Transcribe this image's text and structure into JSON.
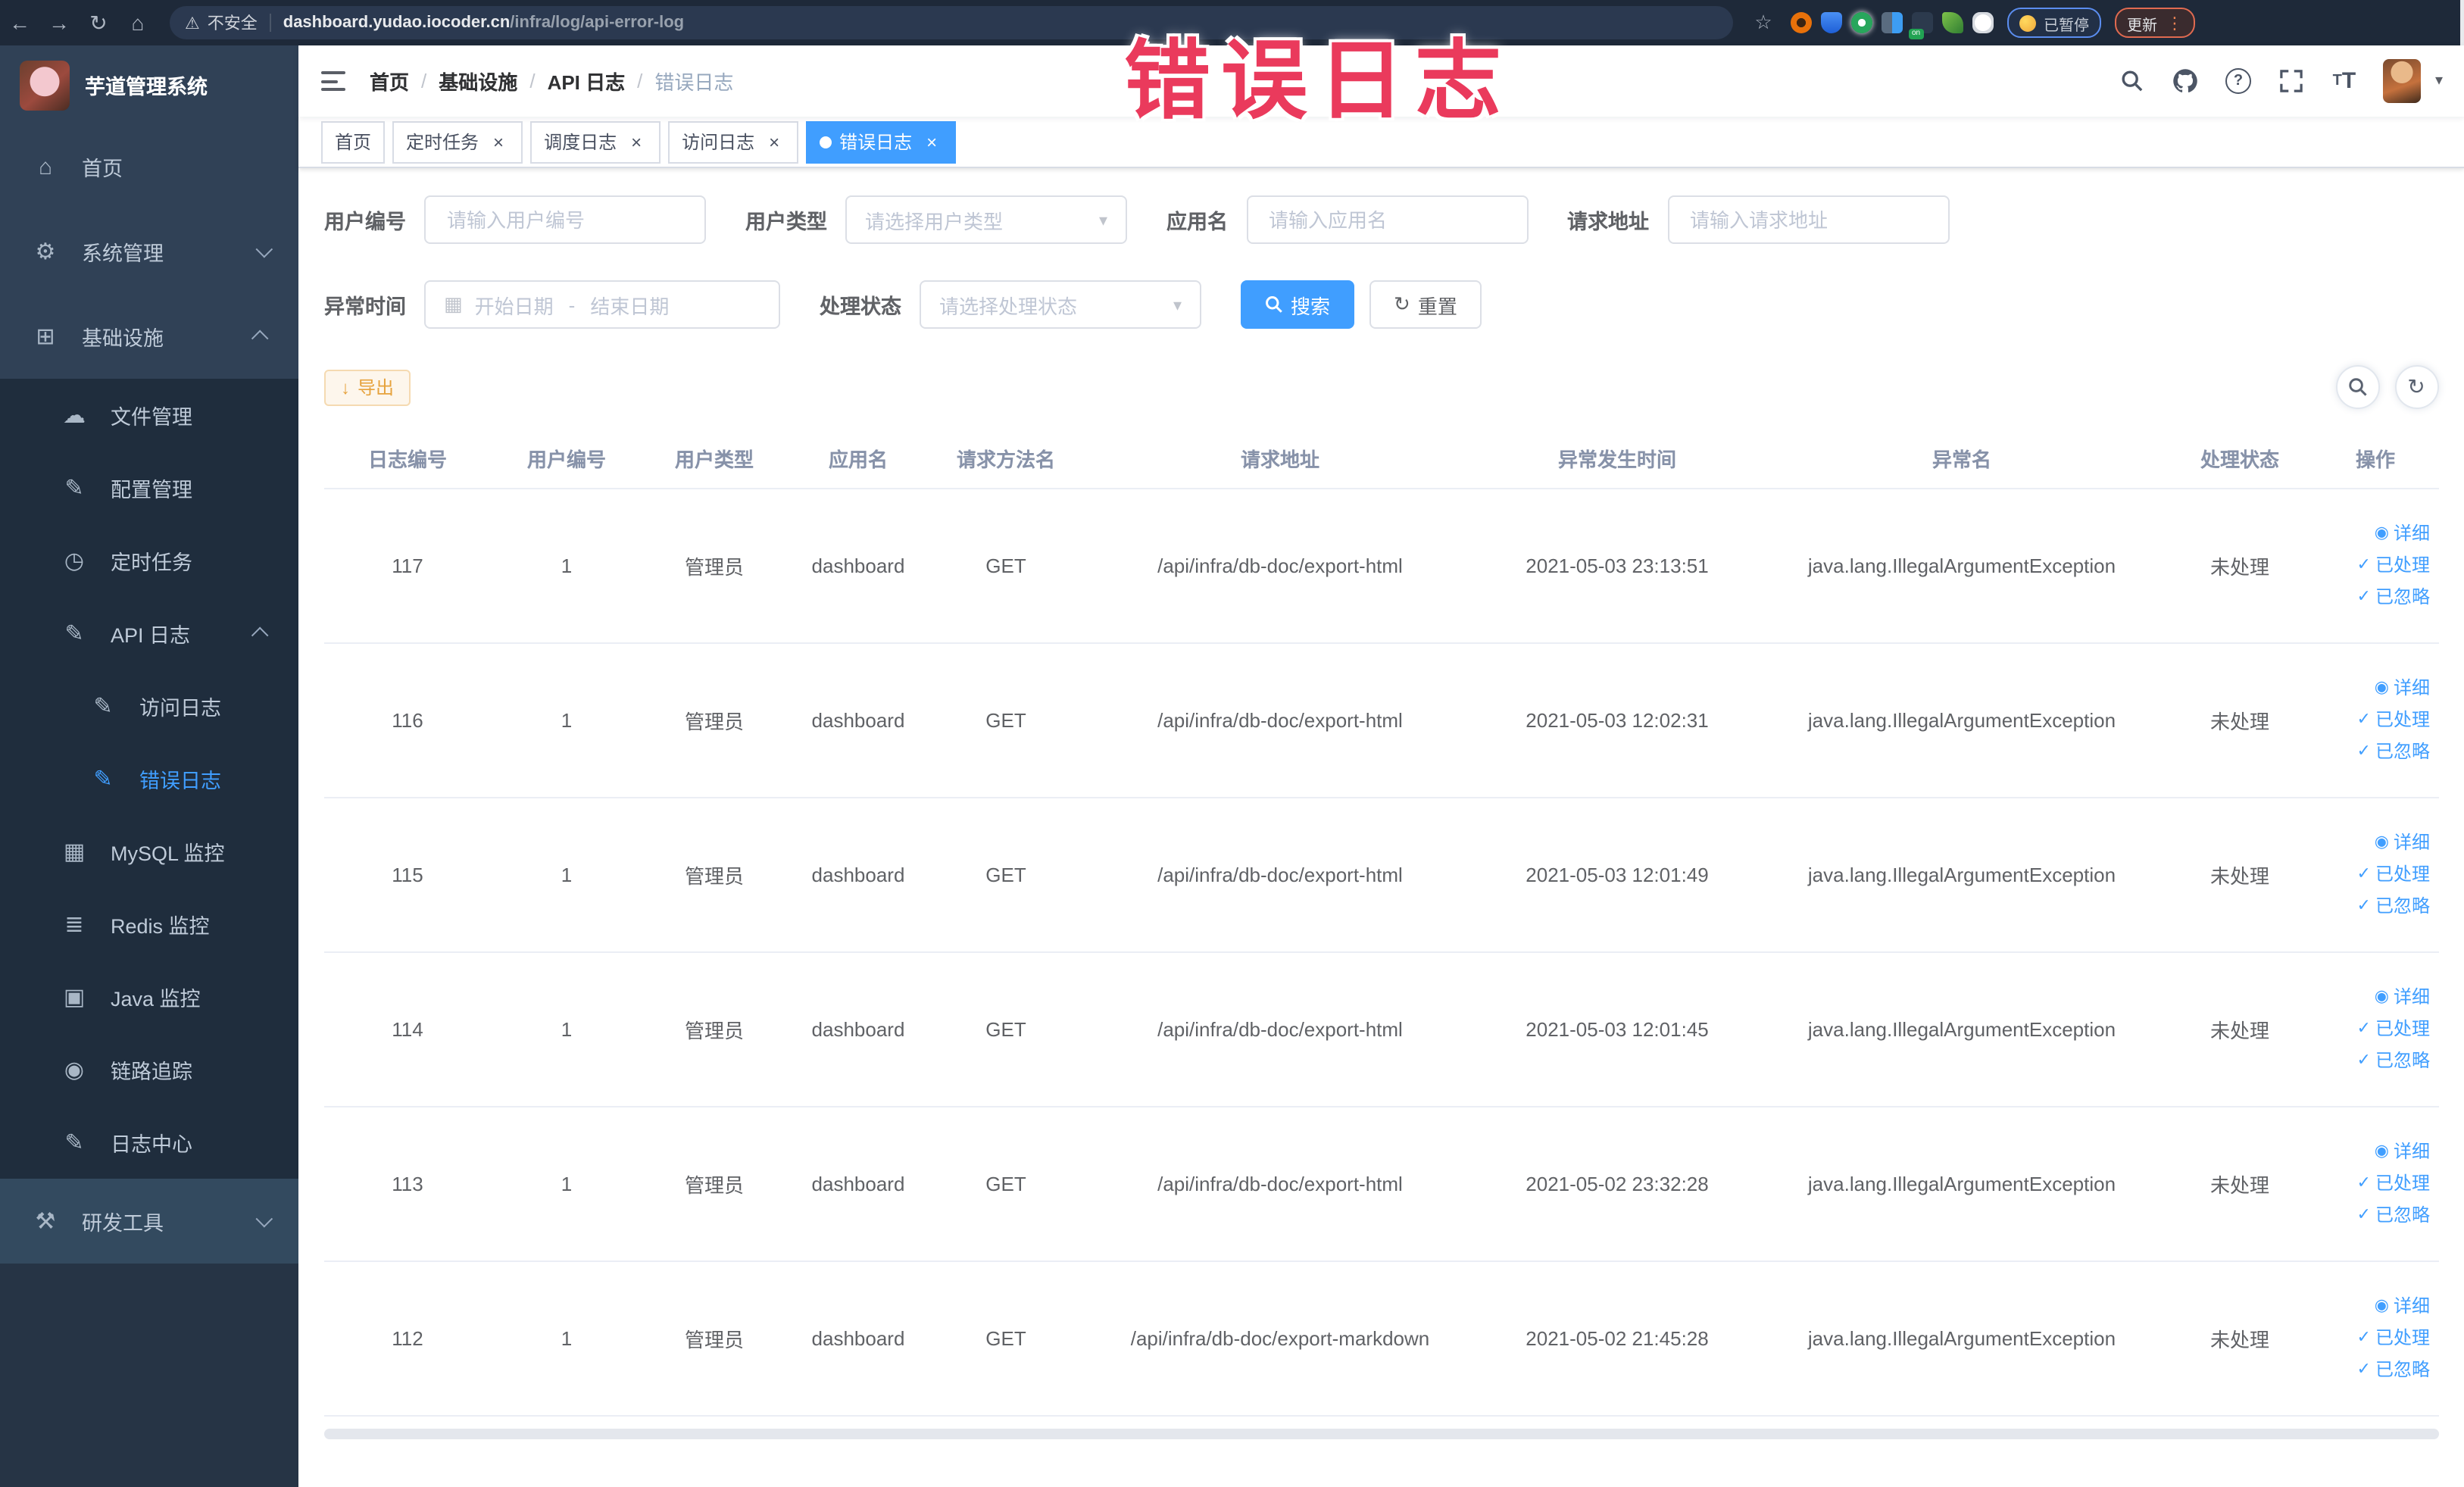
{
  "browser": {
    "security_label": "不安全",
    "url_domain": "dashboard.yudao.iocoder.cn",
    "url_path": "/infra/log/api-error-log",
    "paused_label": "已暂停",
    "update_label": "更新"
  },
  "overlay_text": "错误日志",
  "sidebar": {
    "title": "芋道管理系统",
    "items": [
      {
        "key": "home",
        "label": "首页",
        "icon": "home-icon",
        "level": 0
      },
      {
        "key": "system-management",
        "label": "系统管理",
        "icon": "gear-icon",
        "level": 0,
        "chevron": "down"
      },
      {
        "key": "infrastructure",
        "label": "基础设施",
        "icon": "infrastructure-icon",
        "level": 0,
        "chevron": "up"
      },
      {
        "key": "file-management",
        "label": "文件管理",
        "icon": "cloud-upload-icon",
        "level": 1
      },
      {
        "key": "config-management",
        "label": "配置管理",
        "icon": "edit-icon",
        "level": 1
      },
      {
        "key": "scheduled-jobs",
        "label": "定时任务",
        "icon": "timer-icon",
        "level": 1
      },
      {
        "key": "api-log",
        "label": "API 日志",
        "icon": "log-icon",
        "level": 1,
        "chevron": "up"
      },
      {
        "key": "access-log",
        "label": "访问日志",
        "icon": "log-icon",
        "level": 2
      },
      {
        "key": "error-log",
        "label": "错误日志",
        "icon": "log-icon",
        "level": 2,
        "active": true
      },
      {
        "key": "mysql-monitor",
        "label": "MySQL 监控",
        "icon": "chart-icon",
        "level": 1
      },
      {
        "key": "redis-monitor",
        "label": "Redis 监控",
        "icon": "layers-icon",
        "level": 1
      },
      {
        "key": "java-monitor",
        "label": "Java 监控",
        "icon": "monitor-icon",
        "level": 1
      },
      {
        "key": "trace",
        "label": "链路追踪",
        "icon": "eye-icon",
        "level": 1
      },
      {
        "key": "log-center",
        "label": "日志中心",
        "icon": "log-icon",
        "level": 1
      },
      {
        "key": "dev-tools",
        "label": "研发工具",
        "icon": "toolbox-icon",
        "level": 0,
        "chevron": "down",
        "highlight": true
      }
    ]
  },
  "breadcrumb": {
    "items": [
      "首页",
      "基础设施",
      "API 日志",
      "错误日志"
    ]
  },
  "tabs": [
    {
      "key": "home",
      "label": "首页",
      "closable": false,
      "active": false
    },
    {
      "key": "scheduled-jobs",
      "label": "定时任务",
      "closable": true,
      "active": false
    },
    {
      "key": "schedule-log",
      "label": "调度日志",
      "closable": true,
      "active": false
    },
    {
      "key": "access-log",
      "label": "访问日志",
      "closable": true,
      "active": false
    },
    {
      "key": "error-log",
      "label": "错误日志",
      "closable": true,
      "active": true
    }
  ],
  "filters": {
    "user_id": {
      "label": "用户编号",
      "placeholder": "请输入用户编号"
    },
    "user_type": {
      "label": "用户类型",
      "placeholder": "请选择用户类型"
    },
    "app_name": {
      "label": "应用名",
      "placeholder": "请输入应用名"
    },
    "request_url": {
      "label": "请求地址",
      "placeholder": "请输入请求地址"
    },
    "exception_time": {
      "label": "异常时间",
      "start_placeholder": "开始日期",
      "separator": "-",
      "end_placeholder": "结束日期"
    },
    "process_status": {
      "label": "处理状态",
      "placeholder": "请选择处理状态"
    },
    "search_label": "搜索",
    "reset_label": "重置"
  },
  "toolbar": {
    "export_label": "导出"
  },
  "table": {
    "headers": [
      "日志编号",
      "用户编号",
      "用户类型",
      "应用名",
      "请求方法名",
      "请求地址",
      "异常发生时间",
      "异常名",
      "处理状态",
      "操作"
    ],
    "action_labels": {
      "detail": "详细",
      "processed": "已处理",
      "ignored": "已忽略"
    },
    "rows": [
      {
        "id": "117",
        "user_id": "1",
        "user_type": "管理员",
        "app": "dashboard",
        "method": "GET",
        "url": "/api/infra/db-doc/export-html",
        "time": "2021-05-03 23:13:51",
        "exception": "java.lang.IllegalArgumentException",
        "status": "未处理"
      },
      {
        "id": "116",
        "user_id": "1",
        "user_type": "管理员",
        "app": "dashboard",
        "method": "GET",
        "url": "/api/infra/db-doc/export-html",
        "time": "2021-05-03 12:02:31",
        "exception": "java.lang.IllegalArgumentException",
        "status": "未处理"
      },
      {
        "id": "115",
        "user_id": "1",
        "user_type": "管理员",
        "app": "dashboard",
        "method": "GET",
        "url": "/api/infra/db-doc/export-html",
        "time": "2021-05-03 12:01:49",
        "exception": "java.lang.IllegalArgumentException",
        "status": "未处理"
      },
      {
        "id": "114",
        "user_id": "1",
        "user_type": "管理员",
        "app": "dashboard",
        "method": "GET",
        "url": "/api/infra/db-doc/export-html",
        "time": "2021-05-03 12:01:45",
        "exception": "java.lang.IllegalArgumentException",
        "status": "未处理"
      },
      {
        "id": "113",
        "user_id": "1",
        "user_type": "管理员",
        "app": "dashboard",
        "method": "GET",
        "url": "/api/infra/db-doc/export-html",
        "time": "2021-05-02 23:32:28",
        "exception": "java.lang.IllegalArgumentException",
        "status": "未处理"
      },
      {
        "id": "112",
        "user_id": "1",
        "user_type": "管理员",
        "app": "dashboard",
        "method": "GET",
        "url": "/api/infra/db-doc/export-markdown",
        "time": "2021-05-02 21:45:28",
        "exception": "java.lang.IllegalArgumentException",
        "status": "未处理"
      }
    ]
  },
  "colors": {
    "primary": "#409EFF",
    "warning": "#E6A23C",
    "sidebar_bg": "#304156",
    "submenu_bg": "#1f2d3d",
    "overlay_red": "#EA3A5C"
  }
}
